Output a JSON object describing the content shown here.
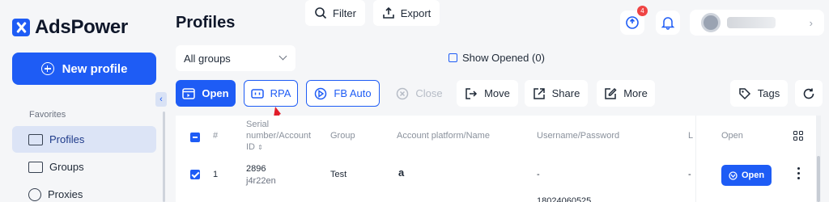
{
  "app": {
    "name": "AdsPower"
  },
  "sidebar": {
    "new_profile_label": "New profile",
    "collapse_glyph": "‹",
    "favorites_label": "Favorites",
    "items": [
      {
        "label": "Profiles",
        "icon": "folder-icon",
        "active": true
      },
      {
        "label": "Groups",
        "icon": "groups-icon",
        "active": false
      },
      {
        "label": "Proxies",
        "icon": "proxies-icon",
        "active": false
      }
    ]
  },
  "header": {
    "title": "Profiles",
    "notification_badge": "4",
    "user_chevron": "›"
  },
  "filters": {
    "group_select": "All groups",
    "filter_label": "Filter",
    "export_label": "Export",
    "show_opened_label": "Show Opened (0)"
  },
  "actions": {
    "open_label": "Open",
    "rpa_label": "RPA",
    "fb_auto_label": "FB Auto",
    "close_label": "Close",
    "move_label": "Move",
    "share_label": "Share",
    "more_label": "More",
    "tags_label": "Tags"
  },
  "table": {
    "columns": {
      "index": "#",
      "serial": "Serial number/Account ID",
      "group": "Group",
      "platform": "Account platform/Name",
      "username": "Username/Password",
      "extra": "L"
    },
    "open_column": "Open",
    "rows": [
      {
        "index": "1",
        "serial": "2896",
        "account_id": "j4r22en",
        "group": "Test",
        "platform_glyph": "a",
        "username": "-",
        "extra": "-",
        "open_label": "Open",
        "next_username_partial": "18024060525"
      }
    ]
  },
  "colors": {
    "accent": "#1e5cf5",
    "annotation_arrow": "#e11d2a"
  }
}
